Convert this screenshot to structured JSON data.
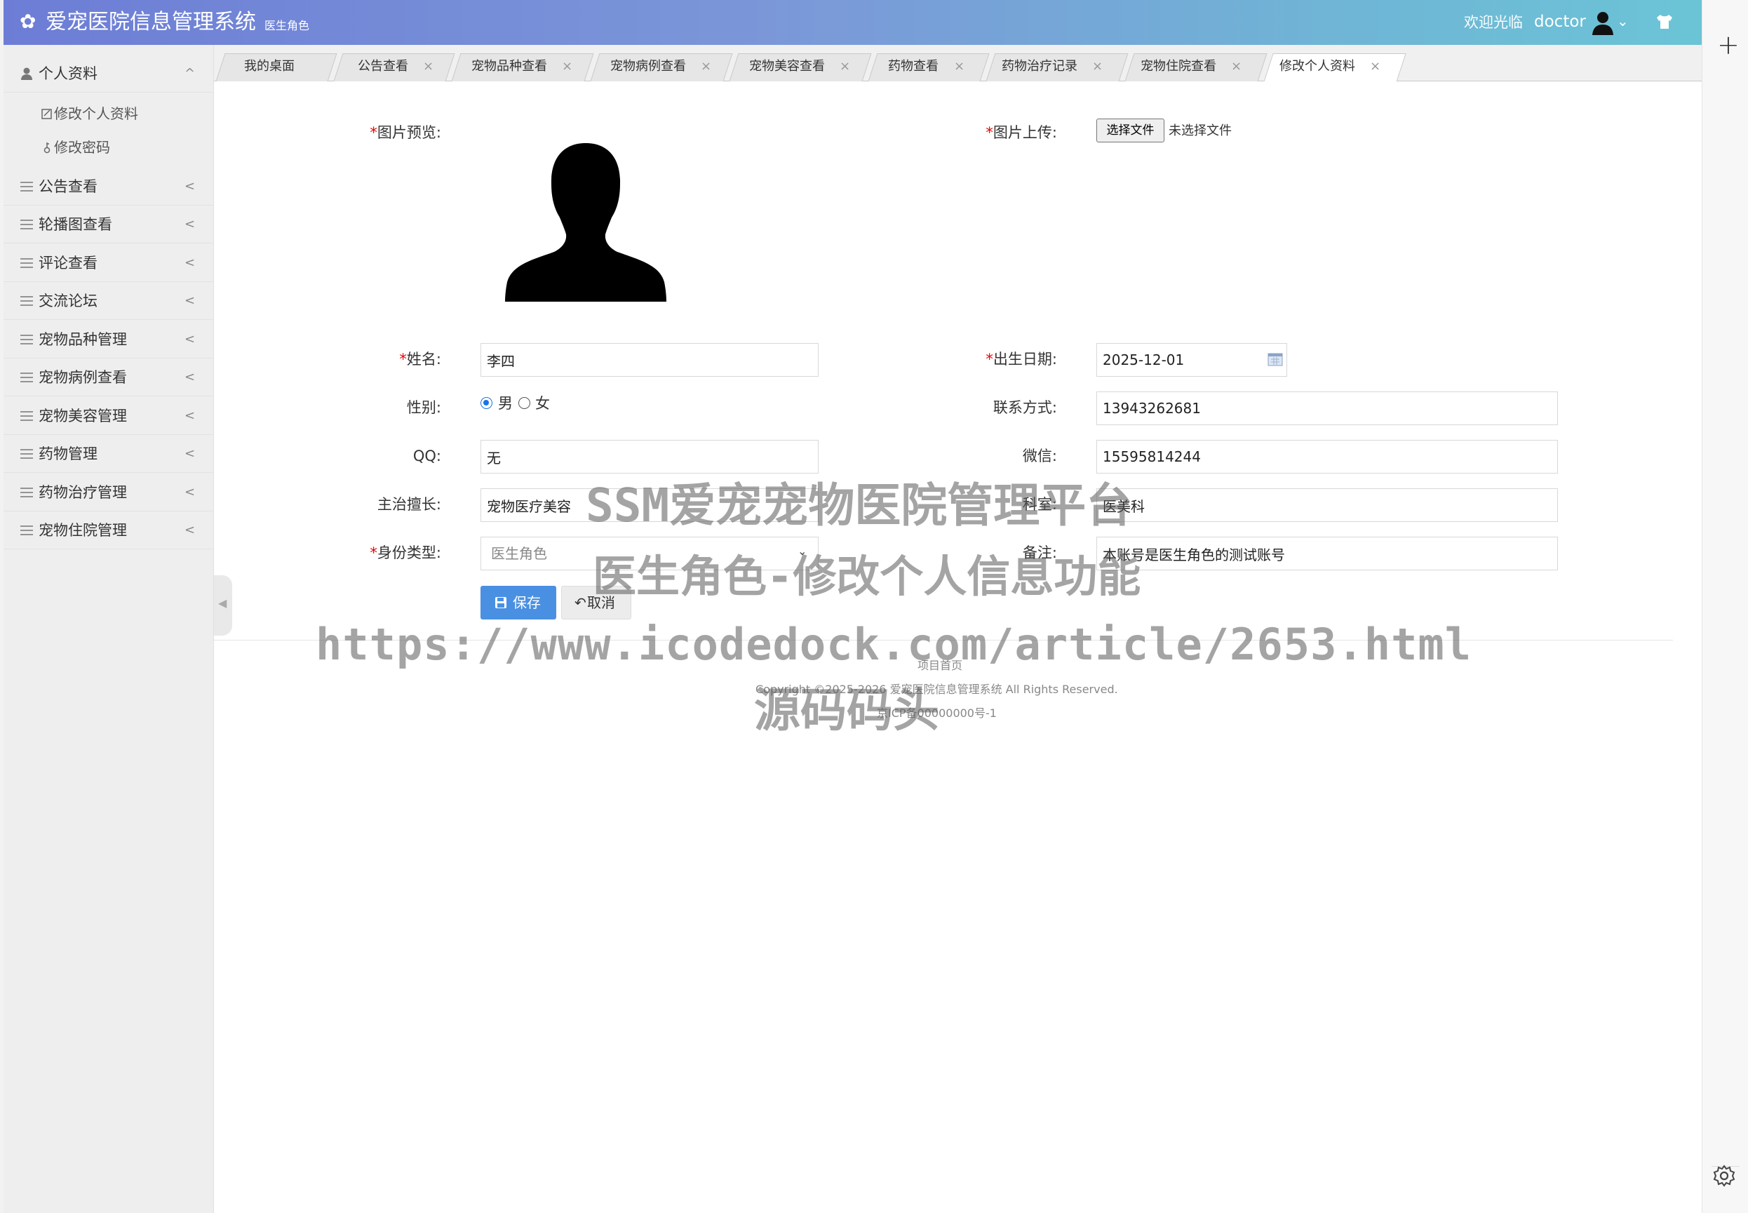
{
  "header": {
    "title": "爱宠医院信息管理系统",
    "role": "医生角色",
    "welcome": "欢迎光临",
    "username": "doctor",
    "icons": [
      "gear-logo-icon",
      "user-avatar-icon",
      "chevron-down-icon",
      "shirt-skin-icon"
    ]
  },
  "sidebar": {
    "groups": [
      {
        "label": "个人资料",
        "expanded": true,
        "items": [
          {
            "label": "修改个人资料",
            "icon": "edit-icon"
          },
          {
            "label": "修改密码",
            "icon": "key-icon"
          }
        ]
      },
      {
        "label": "公告查看"
      },
      {
        "label": "轮播图查看"
      },
      {
        "label": "评论查看"
      },
      {
        "label": "交流论坛"
      },
      {
        "label": "宠物品种管理"
      },
      {
        "label": "宠物病例查看"
      },
      {
        "label": "宠物美容管理"
      },
      {
        "label": "药物管理"
      },
      {
        "label": "药物治疗管理"
      },
      {
        "label": "宠物住院管理"
      }
    ],
    "expand_glyph": "^",
    "collapse_glyph": "<"
  },
  "tabs": [
    {
      "label": "我的桌面",
      "closable": false
    },
    {
      "label": "公告查看",
      "closable": true
    },
    {
      "label": "宠物品种查看",
      "closable": true
    },
    {
      "label": "宠物病例查看",
      "closable": true
    },
    {
      "label": "宠物美容查看",
      "closable": true
    },
    {
      "label": "药物查看",
      "closable": true
    },
    {
      "label": "药物治疗记录",
      "closable": true
    },
    {
      "label": "宠物住院查看",
      "closable": true
    },
    {
      "label": "修改个人资料",
      "closable": true,
      "active": true
    }
  ],
  "tab_close_glyph": "×",
  "form": {
    "required_mark": "*",
    "image_preview_label": "图片预览:",
    "image_upload_label": "图片上传:",
    "file_button": "选择文件",
    "file_status": "未选择文件",
    "name_label": "姓名:",
    "name_value": "李四",
    "birth_label": "出生日期:",
    "birth_value": "2025-12-01",
    "gender_label": "性别:",
    "gender_options": [
      "男",
      "女"
    ],
    "gender_selected": "男",
    "contact_label": "联系方式:",
    "contact_value": "13943262681",
    "qq_label": "QQ:",
    "qq_value": "无",
    "wechat_label": "微信:",
    "wechat_value": "15595814244",
    "specialty_label": "主治擅长:",
    "specialty_value": "宠物医疗美容",
    "department_label": "科室:",
    "department_value": "医美科",
    "identity_label": "身份类型:",
    "identity_value": "医生角色",
    "remark_label": "备注:",
    "remark_value": "本账号是医生角色的测试账号",
    "save_button": "保存",
    "cancel_button": "取消"
  },
  "footer": {
    "home_link": "项目首页",
    "copyright": "Copyright ©2025-2026 爱宠医院信息管理系统 All Rights Reserved.",
    "icp": "京ICP备00000000号-1"
  },
  "watermark": {
    "line1": "SSM爱宠宠物医院管理平台",
    "line2": "医生角色-修改个人信息功能",
    "line3": "https://www.icodedock.com/article/2653.html",
    "line4": "源码码头"
  }
}
